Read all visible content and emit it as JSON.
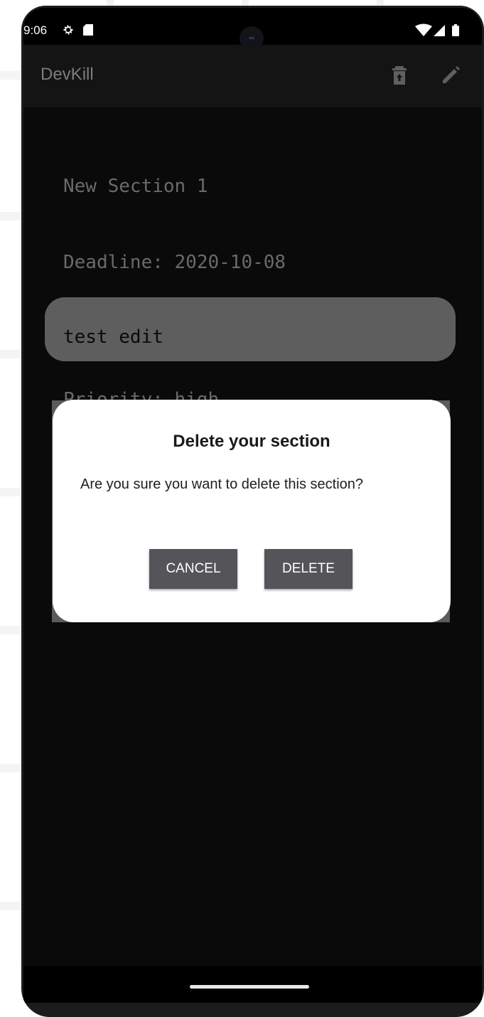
{
  "status_bar": {
    "time": "9:06",
    "icons": [
      "settings-gear-icon",
      "sd-card-icon",
      "wifi-icon",
      "signal-icon",
      "battery-icon"
    ]
  },
  "app_bar": {
    "title": "DevKill",
    "actions": [
      "delete-icon",
      "edit-icon"
    ]
  },
  "section": {
    "title": "New Section 1",
    "deadline": "Deadline: 2020-10-08",
    "body": "test edit",
    "priority": "Priority: high"
  },
  "dialog": {
    "title": "Delete your section",
    "message": "Are you sure you want to delete this section?",
    "cancel_label": "CANCEL",
    "delete_label": "DELETE"
  },
  "colors": {
    "background": "#0a0a0a",
    "app_bar": "#141414",
    "dialog": "#ffffff",
    "button": "#555459"
  }
}
